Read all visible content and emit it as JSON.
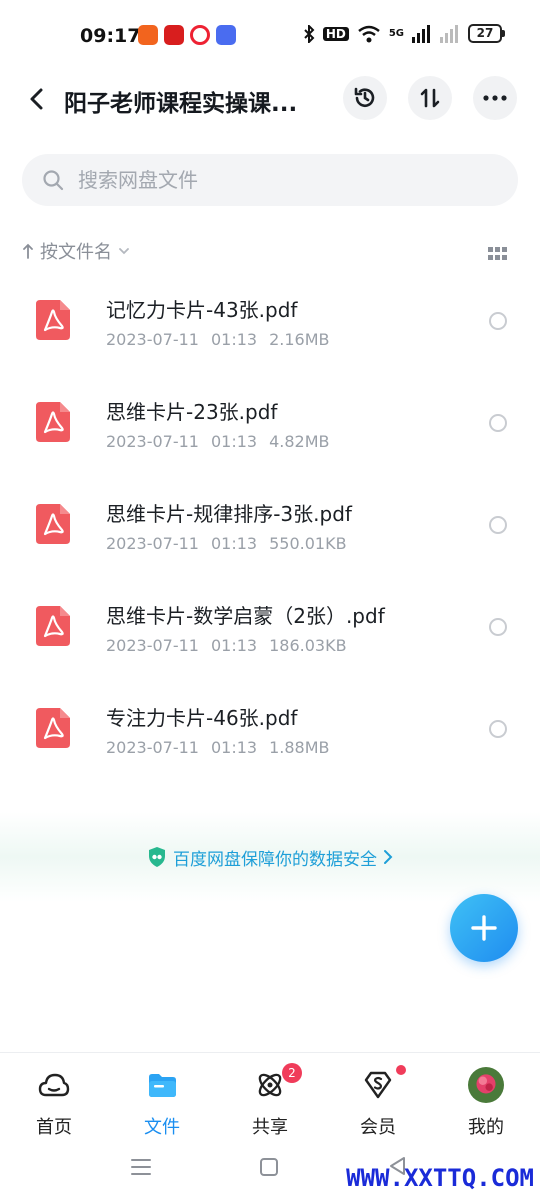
{
  "status_bar": {
    "time": "09:17",
    "network": "5G",
    "hd": "HD",
    "battery": "27"
  },
  "header": {
    "title": "阳子老师课程实操课..."
  },
  "search": {
    "placeholder": "搜索网盘文件"
  },
  "sort": {
    "label": "按文件名"
  },
  "files": [
    {
      "name": "记忆力卡片-43张.pdf",
      "date": "2023-07-11",
      "time": "01:13",
      "size": "2.16MB"
    },
    {
      "name": "思维卡片-23张.pdf",
      "date": "2023-07-11",
      "time": "01:13",
      "size": "4.82MB"
    },
    {
      "name": "思维卡片-规律排序-3张.pdf",
      "date": "2023-07-11",
      "time": "01:13",
      "size": "550.01KB"
    },
    {
      "name": "思维卡片-数学启蒙（2张）.pdf",
      "date": "2023-07-11",
      "time": "01:13",
      "size": "186.03KB"
    },
    {
      "name": "专注力卡片-46张.pdf",
      "date": "2023-07-11",
      "time": "01:13",
      "size": "1.88MB"
    }
  ],
  "security": {
    "text": "百度网盘保障你的数据安全",
    "color": "#1e9fd8"
  },
  "bottom_nav": {
    "items": [
      {
        "label": "首页",
        "icon": "cloud-home-icon",
        "active": false
      },
      {
        "label": "文件",
        "icon": "folder-icon",
        "active": true
      },
      {
        "label": "共享",
        "icon": "share-atom-icon",
        "active": false,
        "badge": "2"
      },
      {
        "label": "会员",
        "icon": "vip-diamond-icon",
        "active": false
      },
      {
        "label": "我的",
        "icon": "avatar",
        "active": false
      }
    ]
  },
  "watermark": "WWW.XXTTQ.COM",
  "colors": {
    "accent": "#1a8ef0",
    "pdf": "#f05a5f",
    "badge": "#f03c5a"
  }
}
